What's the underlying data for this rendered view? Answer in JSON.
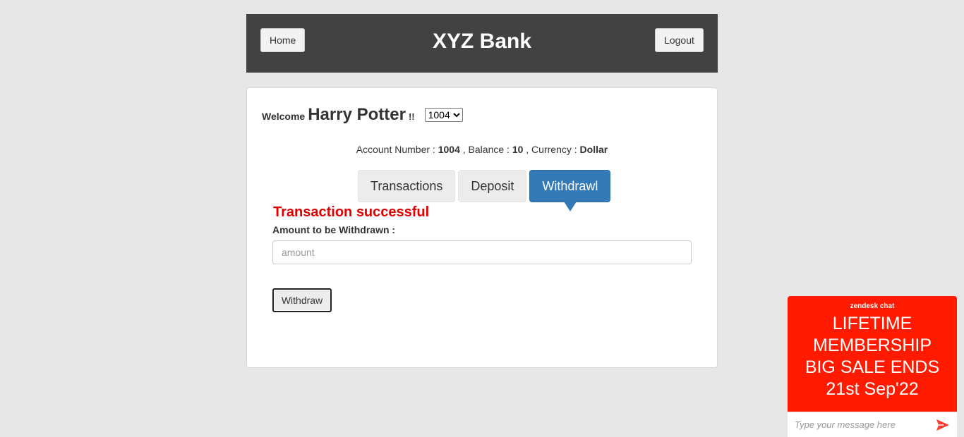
{
  "header": {
    "home_label": "Home",
    "title": "XYZ Bank",
    "logout_label": "Logout"
  },
  "welcome": {
    "label": "Welcome",
    "customer_name": "Harry Potter",
    "exclaim": "!!",
    "selected_account": "1004"
  },
  "account_info": {
    "account_label": "Account Number :",
    "account_number": "1004",
    "balance_label": ", Balance :",
    "balance": "10",
    "currency_label": ", Currency :",
    "currency": "Dollar"
  },
  "tabs": [
    {
      "label": "Transactions",
      "active": false
    },
    {
      "label": "Deposit",
      "active": false
    },
    {
      "label": "Withdrawl",
      "active": true
    }
  ],
  "withdraw_form": {
    "message": "Transaction successful",
    "amount_label": "Amount to be Withdrawn :",
    "amount_placeholder": "amount",
    "submit_label": "Withdraw"
  },
  "chat": {
    "brand": "zendesk chat",
    "promo_line1": "LIFETIME",
    "promo_line2": "MEMBERSHIP",
    "promo_line3": "BIG SALE ENDS",
    "promo_line4": "21st Sep'22",
    "input_placeholder": "Type your message here",
    "icon": "send-icon"
  },
  "colors": {
    "header_bg": "#424242",
    "active_tab": "#337ab7",
    "success_text": "#e00000",
    "chat_bg": "#ff1a00"
  }
}
